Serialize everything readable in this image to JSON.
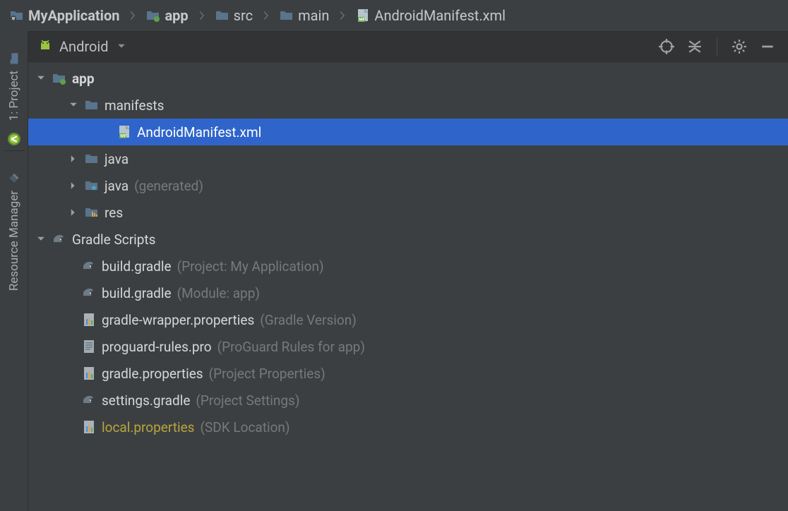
{
  "breadcrumb": [
    {
      "label": "MyApplication",
      "bold": true,
      "icon": "project-folder"
    },
    {
      "label": "app",
      "bold": true,
      "icon": "module-folder"
    },
    {
      "label": "src",
      "bold": false,
      "icon": "folder"
    },
    {
      "label": "main",
      "bold": false,
      "icon": "folder"
    },
    {
      "label": "AndroidManifest.xml",
      "bold": false,
      "icon": "manifest-file"
    }
  ],
  "panel": {
    "viewName": "Android"
  },
  "gutter": {
    "tab1_label": "1: Project",
    "tab2_label": "Resource Manager"
  },
  "tree": {
    "app": {
      "label": "app"
    },
    "manifests": {
      "label": "manifests"
    },
    "androidManifest": {
      "label": "AndroidManifest.xml"
    },
    "java": {
      "label": "java"
    },
    "javaGen": {
      "label": "java",
      "sub": "(generated)"
    },
    "res": {
      "label": "res"
    },
    "gradleScripts": {
      "label": "Gradle Scripts"
    },
    "buildGradleProject": {
      "label": "build.gradle",
      "sub": "(Project: My Application)"
    },
    "buildGradleModule": {
      "label": "build.gradle",
      "sub": "(Module: app)"
    },
    "gradleWrapperProps": {
      "label": "gradle-wrapper.properties",
      "sub": "(Gradle Version)"
    },
    "proguard": {
      "label": "proguard-rules.pro",
      "sub": "(ProGuard Rules for app)"
    },
    "gradleProps": {
      "label": "gradle.properties",
      "sub": "(Project Properties)"
    },
    "settingsGradle": {
      "label": "settings.gradle",
      "sub": "(Project Settings)"
    },
    "localProps": {
      "label": "local.properties",
      "sub": "(SDK Location)"
    }
  }
}
